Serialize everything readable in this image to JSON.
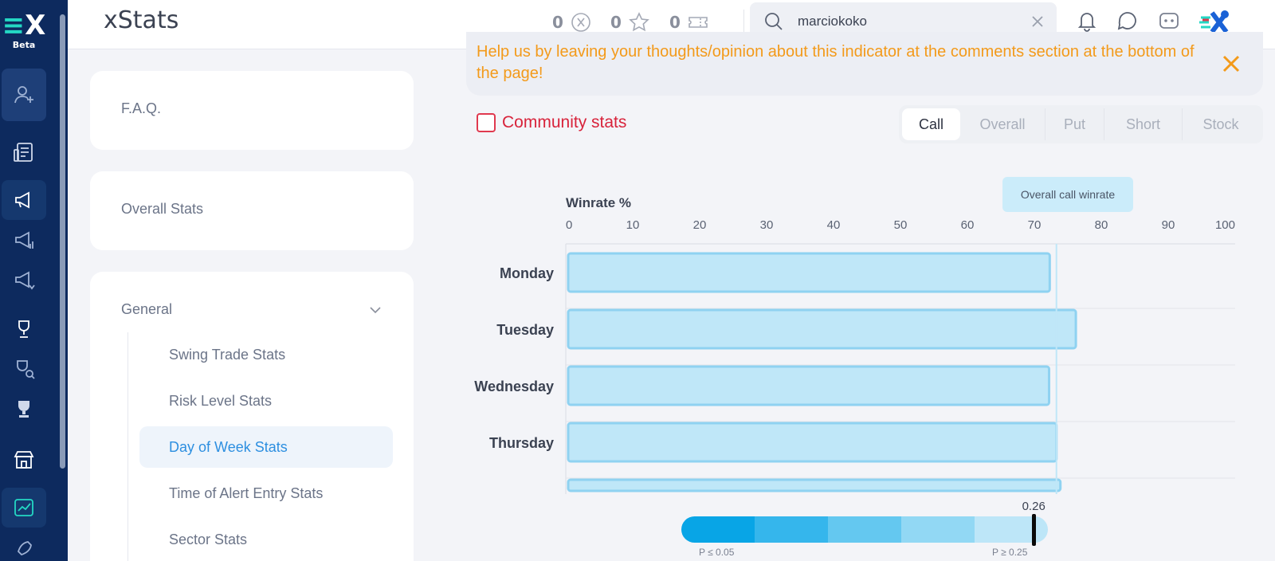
{
  "header": {
    "title": "xStats",
    "counters": [
      {
        "value": "0",
        "icon": "x-coin-icon"
      },
      {
        "value": "0",
        "icon": "star-icon"
      },
      {
        "value": "0",
        "icon": "ticket-icon"
      }
    ],
    "search": {
      "value": "marciokoko",
      "placeholder": "Search"
    }
  },
  "rail": {
    "logo_letter": "X",
    "beta_label": "Beta"
  },
  "sidebar": {
    "faq": "F.A.Q.",
    "overall": "Overall Stats",
    "general": {
      "label": "General",
      "items": [
        {
          "label": "Swing Trade Stats"
        },
        {
          "label": "Risk Level Stats"
        },
        {
          "label": "Day of Week Stats"
        },
        {
          "label": "Time of Alert Entry Stats"
        },
        {
          "label": "Sector Stats"
        }
      ]
    }
  },
  "banner": {
    "text": "Help us by leaving your thoughts/opinion about this indicator at the comments section at the bottom of the page!"
  },
  "filters": {
    "community_label": "Community stats",
    "tabs": [
      {
        "label": "Call",
        "active": true
      },
      {
        "label": "Overall",
        "active": false
      },
      {
        "label": "Put",
        "active": false
      },
      {
        "label": "Short",
        "active": false
      },
      {
        "label": "Stock",
        "active": false
      }
    ]
  },
  "chart_data": {
    "type": "bar",
    "orientation": "horizontal",
    "title": "Winrate %",
    "categories": [
      "Monday",
      "Tuesday",
      "Wednesday",
      "Thursday"
    ],
    "values": [
      72.3,
      76.2,
      72.2,
      73.3
    ],
    "xlim": [
      0,
      100
    ],
    "ticks": [
      0,
      10,
      20,
      30,
      40,
      50,
      60,
      70,
      80,
      90,
      100
    ],
    "reference_line": {
      "label": "Overall call winrate",
      "value": 73.3
    },
    "grid": true
  },
  "significance_legend": {
    "value": "0.26",
    "marker_fraction": 0.96,
    "low_label": "P ≤ 0.05",
    "high_label": "P ≥ 0.25",
    "colors": [
      "#08a5e6",
      "#35b6ec",
      "#64c8f0",
      "#92d8f4",
      "#bde6f8"
    ]
  },
  "colors": {
    "rail": "#0d2a5e",
    "accent": "#2d8fe0",
    "bar_fill": "#bfe7f8",
    "bar_stroke": "#8fd2f1",
    "warning": "#f39a1a",
    "danger": "#d8233b"
  }
}
